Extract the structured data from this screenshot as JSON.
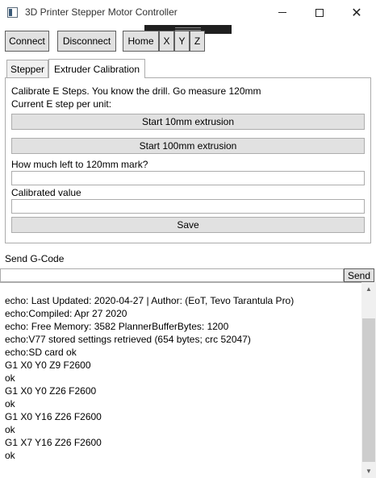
{
  "window": {
    "title": "3D Printer Stepper Motor Controller",
    "min_icon": "minimize-icon",
    "max_icon": "maximize-icon",
    "close_glyph": "✕"
  },
  "toolbar": {
    "connect": "Connect",
    "disconnect": "Disconnect",
    "home": "Home",
    "x": "X",
    "y": "Y",
    "z": "Z"
  },
  "tabs": [
    {
      "label": "Stepper"
    },
    {
      "label": "Extruder Calibration"
    }
  ],
  "calibration": {
    "intro": "Calibrate E Steps. You know the drill. Go measure 120mm",
    "current_label": "Current E step per unit:",
    "start_10": "Start 10mm extrusion",
    "start_100": "Start 100mm extrusion",
    "remaining_label": "How much left to 120mm mark?",
    "remaining_value": "",
    "calibrated_label": "Calibrated value",
    "calibrated_value": "",
    "save": "Save"
  },
  "gcode": {
    "label": "Send G-Code",
    "value": "",
    "send": "Send"
  },
  "log": [
    "echo: Last Updated: 2020-04-27 | Author: (EoT, Tevo Tarantula Pro)",
    "echo:Compiled: Apr 27 2020",
    "echo: Free Memory: 3582  PlannerBufferBytes: 1200",
    "echo:V77 stored settings retrieved (654 bytes; crc 52047)",
    "echo:SD card ok",
    "G1 X0 Y0 Z9 F2600",
    "ok",
    "G1 X0 Y0 Z26 F2600",
    "ok",
    "G1 X0 Y16 Z26 F2600",
    "ok",
    "G1 X7 Y16 Z26 F2600",
    "ok"
  ]
}
